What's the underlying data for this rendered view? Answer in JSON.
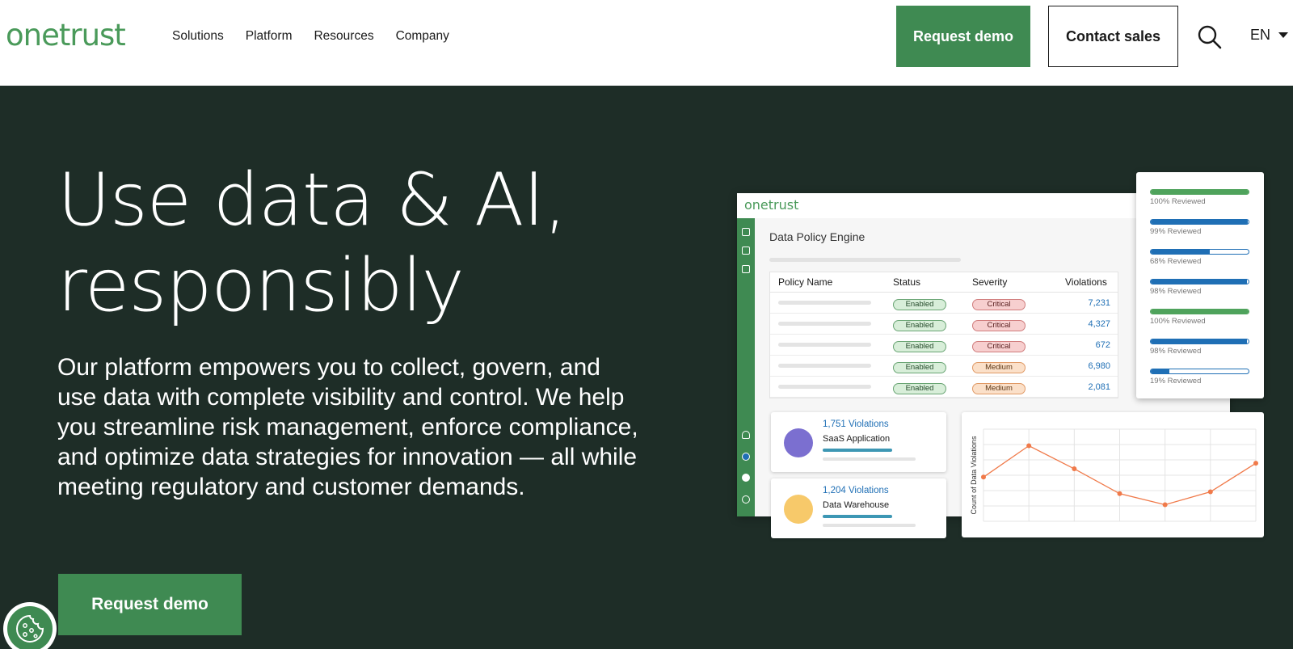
{
  "header": {
    "logo": "onetrust",
    "nav": [
      "Solutions",
      "Platform",
      "Resources",
      "Company"
    ],
    "request_demo": "Request demo",
    "contact_sales": "Contact sales",
    "language": "EN",
    "search_icon": "search-icon"
  },
  "hero": {
    "title": "Use data & AI,\nresponsibly",
    "body": "Our platform empowers you to collect, govern, and use data with complete visibility and control. We help you streamline risk management, enforce compliance, and optimize data strategies for innovation — all while meeting regulatory and customer demands.",
    "cta": "Request demo"
  },
  "colors": {
    "brand_green": "#3f8a52",
    "hero_bg": "#1e2d27",
    "link_blue": "#1f6fb5"
  },
  "dashboard": {
    "logo": "onetrust",
    "title": "Data Policy Engine",
    "columns": [
      "Policy Name",
      "Status",
      "Severity",
      "Violations"
    ],
    "rows": [
      {
        "status": "Enabled",
        "severity": "Critical",
        "severity_kind": "critical",
        "violations": "7,231"
      },
      {
        "status": "Enabled",
        "severity": "Critical",
        "severity_kind": "critical",
        "violations": "4,327"
      },
      {
        "status": "Enabled",
        "severity": "Critical",
        "severity_kind": "critical",
        "violations": "672"
      },
      {
        "status": "Enabled",
        "severity": "Medium",
        "severity_kind": "medium",
        "violations": "6,980"
      },
      {
        "status": "Enabled",
        "severity": "Medium",
        "severity_kind": "medium",
        "violations": "2,081"
      }
    ],
    "violation_cards": [
      {
        "violations": "1,751 Violations",
        "name": "SaaS Application",
        "color": "#7b6fd0"
      },
      {
        "violations": "1,204 Violations",
        "name": "Data Warehouse",
        "color": "#f7c96a"
      }
    ],
    "reviews": [
      {
        "label": "100% Reviewed",
        "value": 1.0,
        "color": "#4fa35c"
      },
      {
        "label": "99% Reviewed",
        "value": 0.99,
        "color": "#1f6fb5"
      },
      {
        "label": "68% Reviewed",
        "value": 0.6,
        "color": "#1f6fb5"
      },
      {
        "label": "98% Reviewed",
        "value": 0.98,
        "color": "#1f6fb5"
      },
      {
        "label": "100% Reviewed",
        "value": 1.0,
        "color": "#4fa35c"
      },
      {
        "label": "98% Reviewed",
        "value": 0.98,
        "color": "#1f6fb5"
      },
      {
        "label": "19% Reviewed",
        "value": 0.19,
        "color": "#1f6fb5"
      }
    ],
    "line_chart": {
      "ylabel": "Count of Data Violations",
      "values": [
        48,
        82,
        57,
        30,
        18,
        32,
        63
      ],
      "ylim": [
        0,
        100
      ],
      "line_color": "#f07a4a"
    }
  }
}
